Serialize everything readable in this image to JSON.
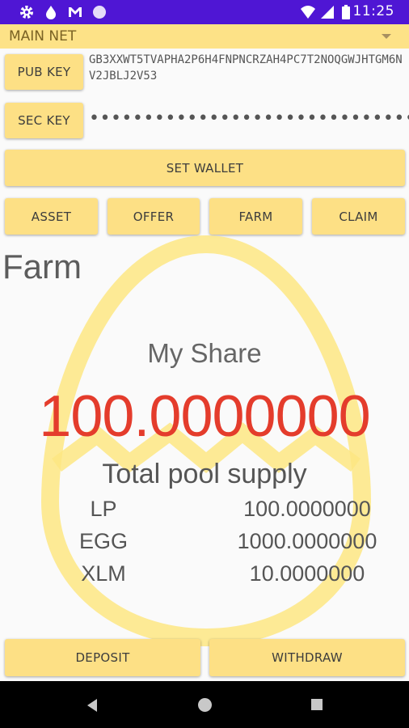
{
  "status_bar": {
    "time": "11:25",
    "icons": [
      "settings-icon",
      "drop-icon",
      "gmail-icon",
      "circle-icon",
      "wifi-icon",
      "signal-icon",
      "battery-icon"
    ]
  },
  "network": {
    "selected": "MAIN NET"
  },
  "wallet": {
    "pub_key_label": "PUB KEY",
    "pub_key_value": "GB3XXWT5TVAPHA2P6H4FNPNCRZAH4PC7T2NOQGWJHTGM6NV2JBLJ2V53",
    "sec_key_label": "SEC KEY",
    "sec_key_mask": "•••••••••••••••••••••••••••••••••••••••••••••••",
    "set_wallet_label": "SET WALLET"
  },
  "tabs": {
    "asset": "ASSET",
    "offer": "OFFER",
    "farm": "FARM",
    "claim": "CLAIM"
  },
  "farm": {
    "title": "Farm",
    "my_share_label": "My Share",
    "my_share_value": "100.0000000",
    "pool_title": "Total pool supply",
    "pool": [
      {
        "symbol": "LP",
        "amount": "100.0000000"
      },
      {
        "symbol": "EGG",
        "amount": "1000.0000000"
      },
      {
        "symbol": "XLM",
        "amount": "10.0000000"
      }
    ],
    "deposit_label": "DEPOSIT",
    "withdraw_label": "WITHDRAW"
  },
  "colors": {
    "status_bar": "#4f16d4",
    "accent_yellow": "#fde085",
    "share_value_red": "#e43c2c",
    "egg_watermark": "#fde682"
  }
}
